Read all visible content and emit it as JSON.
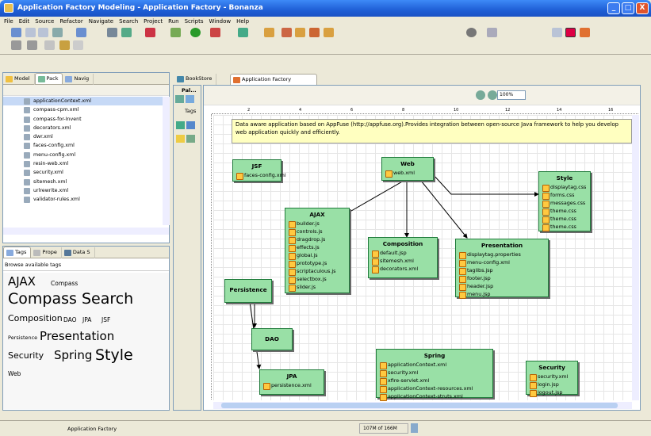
{
  "window": {
    "title": "Application Factory Modeling - Application Factory - Bonanza",
    "min": "_",
    "max": "□",
    "close": "X"
  },
  "menu": [
    "File",
    "Edit",
    "Source",
    "Refactor",
    "Navigate",
    "Search",
    "Project",
    "Run",
    "Scripts",
    "Window",
    "Help"
  ],
  "left_top": {
    "tabs": [
      "Model",
      "Pack",
      "Navig"
    ],
    "files": [
      "applicationContext.xml",
      "compass-cpm.xml",
      "compass-for-Invent",
      "decorators.xml",
      "dwr.xml",
      "faces-config.xml",
      "menu-config.xml",
      "resin-web.xml",
      "security.xml",
      "sitemesh.xml",
      "urlrewrite.xml",
      "validator-rules.xml"
    ]
  },
  "left_bottom": {
    "tabs": [
      "Tags",
      "Prope",
      "Data S"
    ],
    "browse_label": "Browse available tags",
    "tags": [
      {
        "text": "AJAX",
        "size": "large"
      },
      {
        "text": "Compass",
        "size": "small"
      },
      {
        "text": "Compass Search",
        "size": "xlarge"
      },
      {
        "text": "Composition",
        "size": "medium"
      },
      {
        "text": "DAO",
        "size": "small"
      },
      {
        "text": "JPA",
        "size": "small"
      },
      {
        "text": "JSF",
        "size": "small"
      },
      {
        "text": "Persistence",
        "size": "tiny"
      },
      {
        "text": "Presentation",
        "size": "large"
      },
      {
        "text": "Security",
        "size": "medium"
      },
      {
        "text": "Spring",
        "size": "large"
      },
      {
        "text": "Style",
        "size": "xlarge"
      },
      {
        "text": "Web",
        "size": "small"
      }
    ]
  },
  "palette": {
    "title": "Pal...",
    "tags_label": "Tags"
  },
  "editor": {
    "tabs": [
      "BookStore",
      "Application Factory"
    ],
    "zoom": "100%",
    "ruler": [
      "2",
      "4",
      "6",
      "8",
      "10",
      "12",
      "14",
      "16"
    ],
    "note": "Data aware application based on AppFuse (http://appfuse.org).Provides integration between open-source Java framework to help you develop web application quickly and efficiently.",
    "nodes": {
      "jsf": {
        "title": "JSF",
        "items": [
          "faces-config.xml"
        ]
      },
      "web": {
        "title": "Web",
        "items": [
          "web.xml"
        ]
      },
      "style": {
        "title": "Style",
        "items": [
          "displaytag.css",
          "forms.css",
          "messages.css",
          "theme.css",
          "theme.css",
          "theme.css"
        ]
      },
      "ajax": {
        "title": "AJAX",
        "items": [
          "builder.js",
          "controls.js",
          "dragdrop.js",
          "effects.js",
          "global.js",
          "prototype.js",
          "scriptaculous.js",
          "selectbox.js",
          "slider.js"
        ]
      },
      "composition": {
        "title": "Composition",
        "items": [
          "default.jsp",
          "sitemesh.xml",
          "decorators.xml"
        ]
      },
      "presentation": {
        "title": "Presentation",
        "items": [
          "displaytag.properties",
          "menu-config.xml",
          "taglibs.jsp",
          "footer.jsp",
          "header.jsp",
          "menu.jsp"
        ]
      },
      "persistence": {
        "title": "Persistence",
        "items": []
      },
      "dao": {
        "title": "DAO",
        "items": []
      },
      "jpa": {
        "title": "JPA",
        "items": [
          "persistence.xml"
        ]
      },
      "spring": {
        "title": "Spring",
        "items": [
          "applicationContext.xml",
          "security.xml",
          "xfire-servlet.xml",
          "applicationContext-resources.xml",
          "applicationContext-struts.xml"
        ]
      },
      "security": {
        "title": "Security",
        "items": [
          "security.xml",
          "login.jsp",
          "logout.jsp"
        ]
      }
    }
  },
  "status": {
    "text": "Application Factory",
    "memory": "107M of 166M"
  }
}
